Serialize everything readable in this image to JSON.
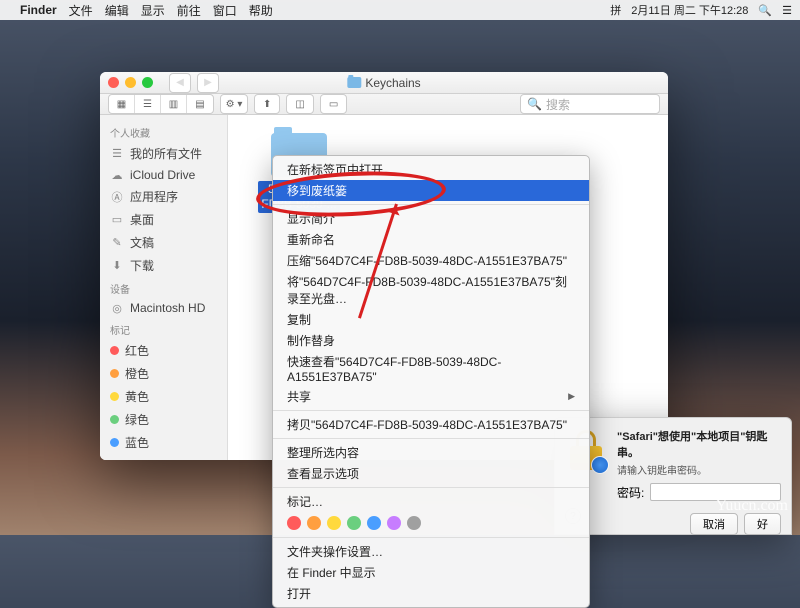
{
  "menubar": {
    "app": "Finder",
    "items": [
      "文件",
      "编辑",
      "显示",
      "前往",
      "窗口",
      "帮助"
    ],
    "input_method": "拼",
    "datetime": "2月11日 周二 下午12:28"
  },
  "window": {
    "title": "Keychains",
    "search_placeholder": "搜索",
    "file_label_1": "564D7C4F-",
    "file_label_2": "FD8B-5039-..."
  },
  "sidebar": {
    "favorites_head": "个人收藏",
    "favorites": [
      {
        "icon": "☰",
        "label": "我的所有文件"
      },
      {
        "icon": "☁",
        "label": "iCloud Drive"
      },
      {
        "icon": "Ⓐ",
        "label": "应用程序"
      },
      {
        "icon": "▭",
        "label": "桌面"
      },
      {
        "icon": "✎",
        "label": "文稿"
      },
      {
        "icon": "⬇",
        "label": "下载"
      }
    ],
    "devices_head": "设备",
    "devices": [
      {
        "icon": "◎",
        "label": "Macintosh HD"
      }
    ],
    "tags_head": "标记",
    "tags": [
      {
        "color": "#ff5b5b",
        "label": "红色"
      },
      {
        "color": "#ff9f40",
        "label": "橙色"
      },
      {
        "color": "#ffd93d",
        "label": "黄色"
      },
      {
        "color": "#6bcf7f",
        "label": "绿色"
      },
      {
        "color": "#4a9eff",
        "label": "蓝色"
      }
    ]
  },
  "context_menu": {
    "items": [
      {
        "label": "在新标签页中打开"
      },
      {
        "label": "移到废纸篓",
        "highlight": true
      },
      {
        "sep": true
      },
      {
        "label": "显示简介"
      },
      {
        "label": "重新命名"
      },
      {
        "label": "压缩\"564D7C4F-FD8B-5039-48DC-A1551E37BA75\""
      },
      {
        "label": "将\"564D7C4F-FD8B-5039-48DC-A1551E37BA75\"刻录至光盘…"
      },
      {
        "label": "复制"
      },
      {
        "label": "制作替身"
      },
      {
        "label": "快速查看\"564D7C4F-FD8B-5039-48DC-A1551E37BA75\""
      },
      {
        "label": "共享",
        "arrow": true
      },
      {
        "sep": true
      },
      {
        "label": "拷贝\"564D7C4F-FD8B-5039-48DC-A1551E37BA75\""
      },
      {
        "sep": true
      },
      {
        "label": "整理所选内容"
      },
      {
        "label": "查看显示选项"
      },
      {
        "sep": true
      },
      {
        "label": "标记…"
      },
      {
        "tags": true
      },
      {
        "sep": true
      },
      {
        "label": "文件夹操作设置…"
      },
      {
        "label": "在 Finder 中显示"
      },
      {
        "label": "打开"
      }
    ],
    "tag_colors": [
      "#ff5b5b",
      "#ff9f40",
      "#ffd93d",
      "#6bcf7f",
      "#4a9eff",
      "#c77dff",
      "#a0a0a0"
    ]
  },
  "keychain": {
    "title": "\"Safari\"想使用\"本地项目\"钥匙串。",
    "subtitle": "请输入钥匙串密码。",
    "password_label": "密码:",
    "cancel": "取消",
    "ok": "好"
  },
  "watermark": "Yuucn.com"
}
